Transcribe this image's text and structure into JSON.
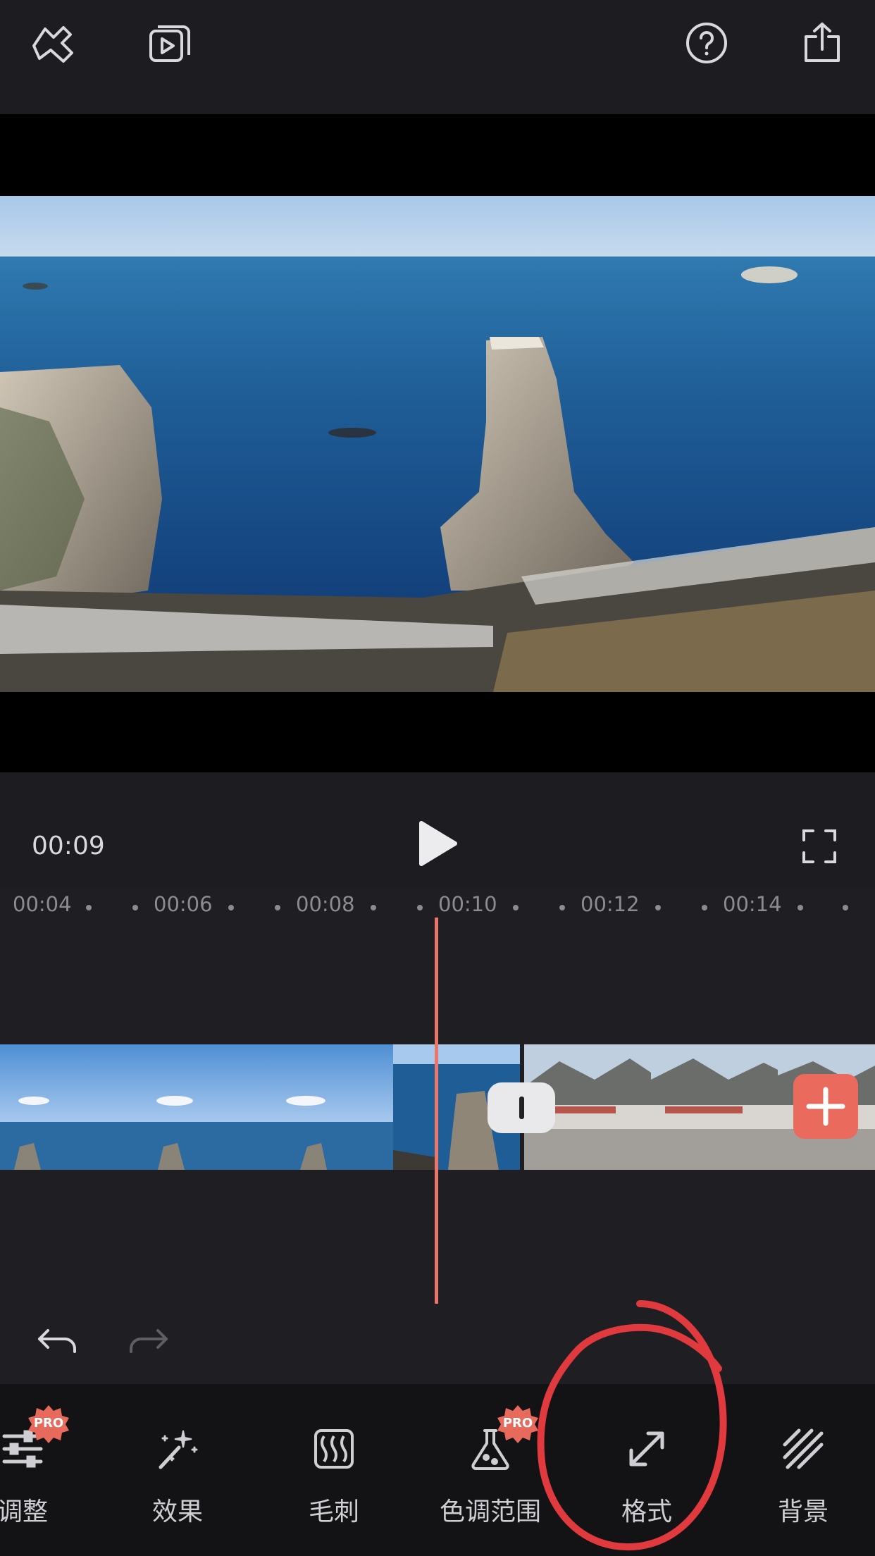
{
  "topbar": {
    "icons": [
      "brand-logo-icon",
      "video-library-icon",
      "help-icon",
      "share-icon"
    ]
  },
  "player": {
    "current_time": "00:09",
    "icons": [
      "play-icon",
      "fullscreen-icon"
    ]
  },
  "timeline": {
    "ruler_ticks": [
      "00:04",
      "00:06",
      "00:08",
      "00:10",
      "00:12",
      "00:14"
    ],
    "clips": [
      "coastal-rock-clip",
      "mountain-village-clip"
    ],
    "accent_color": "#e8766a"
  },
  "history": {
    "icons": [
      "undo-icon",
      "redo-icon"
    ]
  },
  "toolbar": {
    "items": [
      {
        "label": "调整",
        "icon": "sliders-icon",
        "pro": true
      },
      {
        "label": "效果",
        "icon": "magic-wand-icon",
        "pro": false
      },
      {
        "label": "毛刺",
        "icon": "glitch-icon",
        "pro": false
      },
      {
        "label": "色调范围",
        "icon": "flask-icon",
        "pro": true
      },
      {
        "label": "格式",
        "icon": "resize-icon",
        "pro": false
      },
      {
        "label": "背景",
        "icon": "stripes-icon",
        "pro": false
      }
    ],
    "pro_badge": "PRO",
    "badge_color": "#e86a5d"
  }
}
